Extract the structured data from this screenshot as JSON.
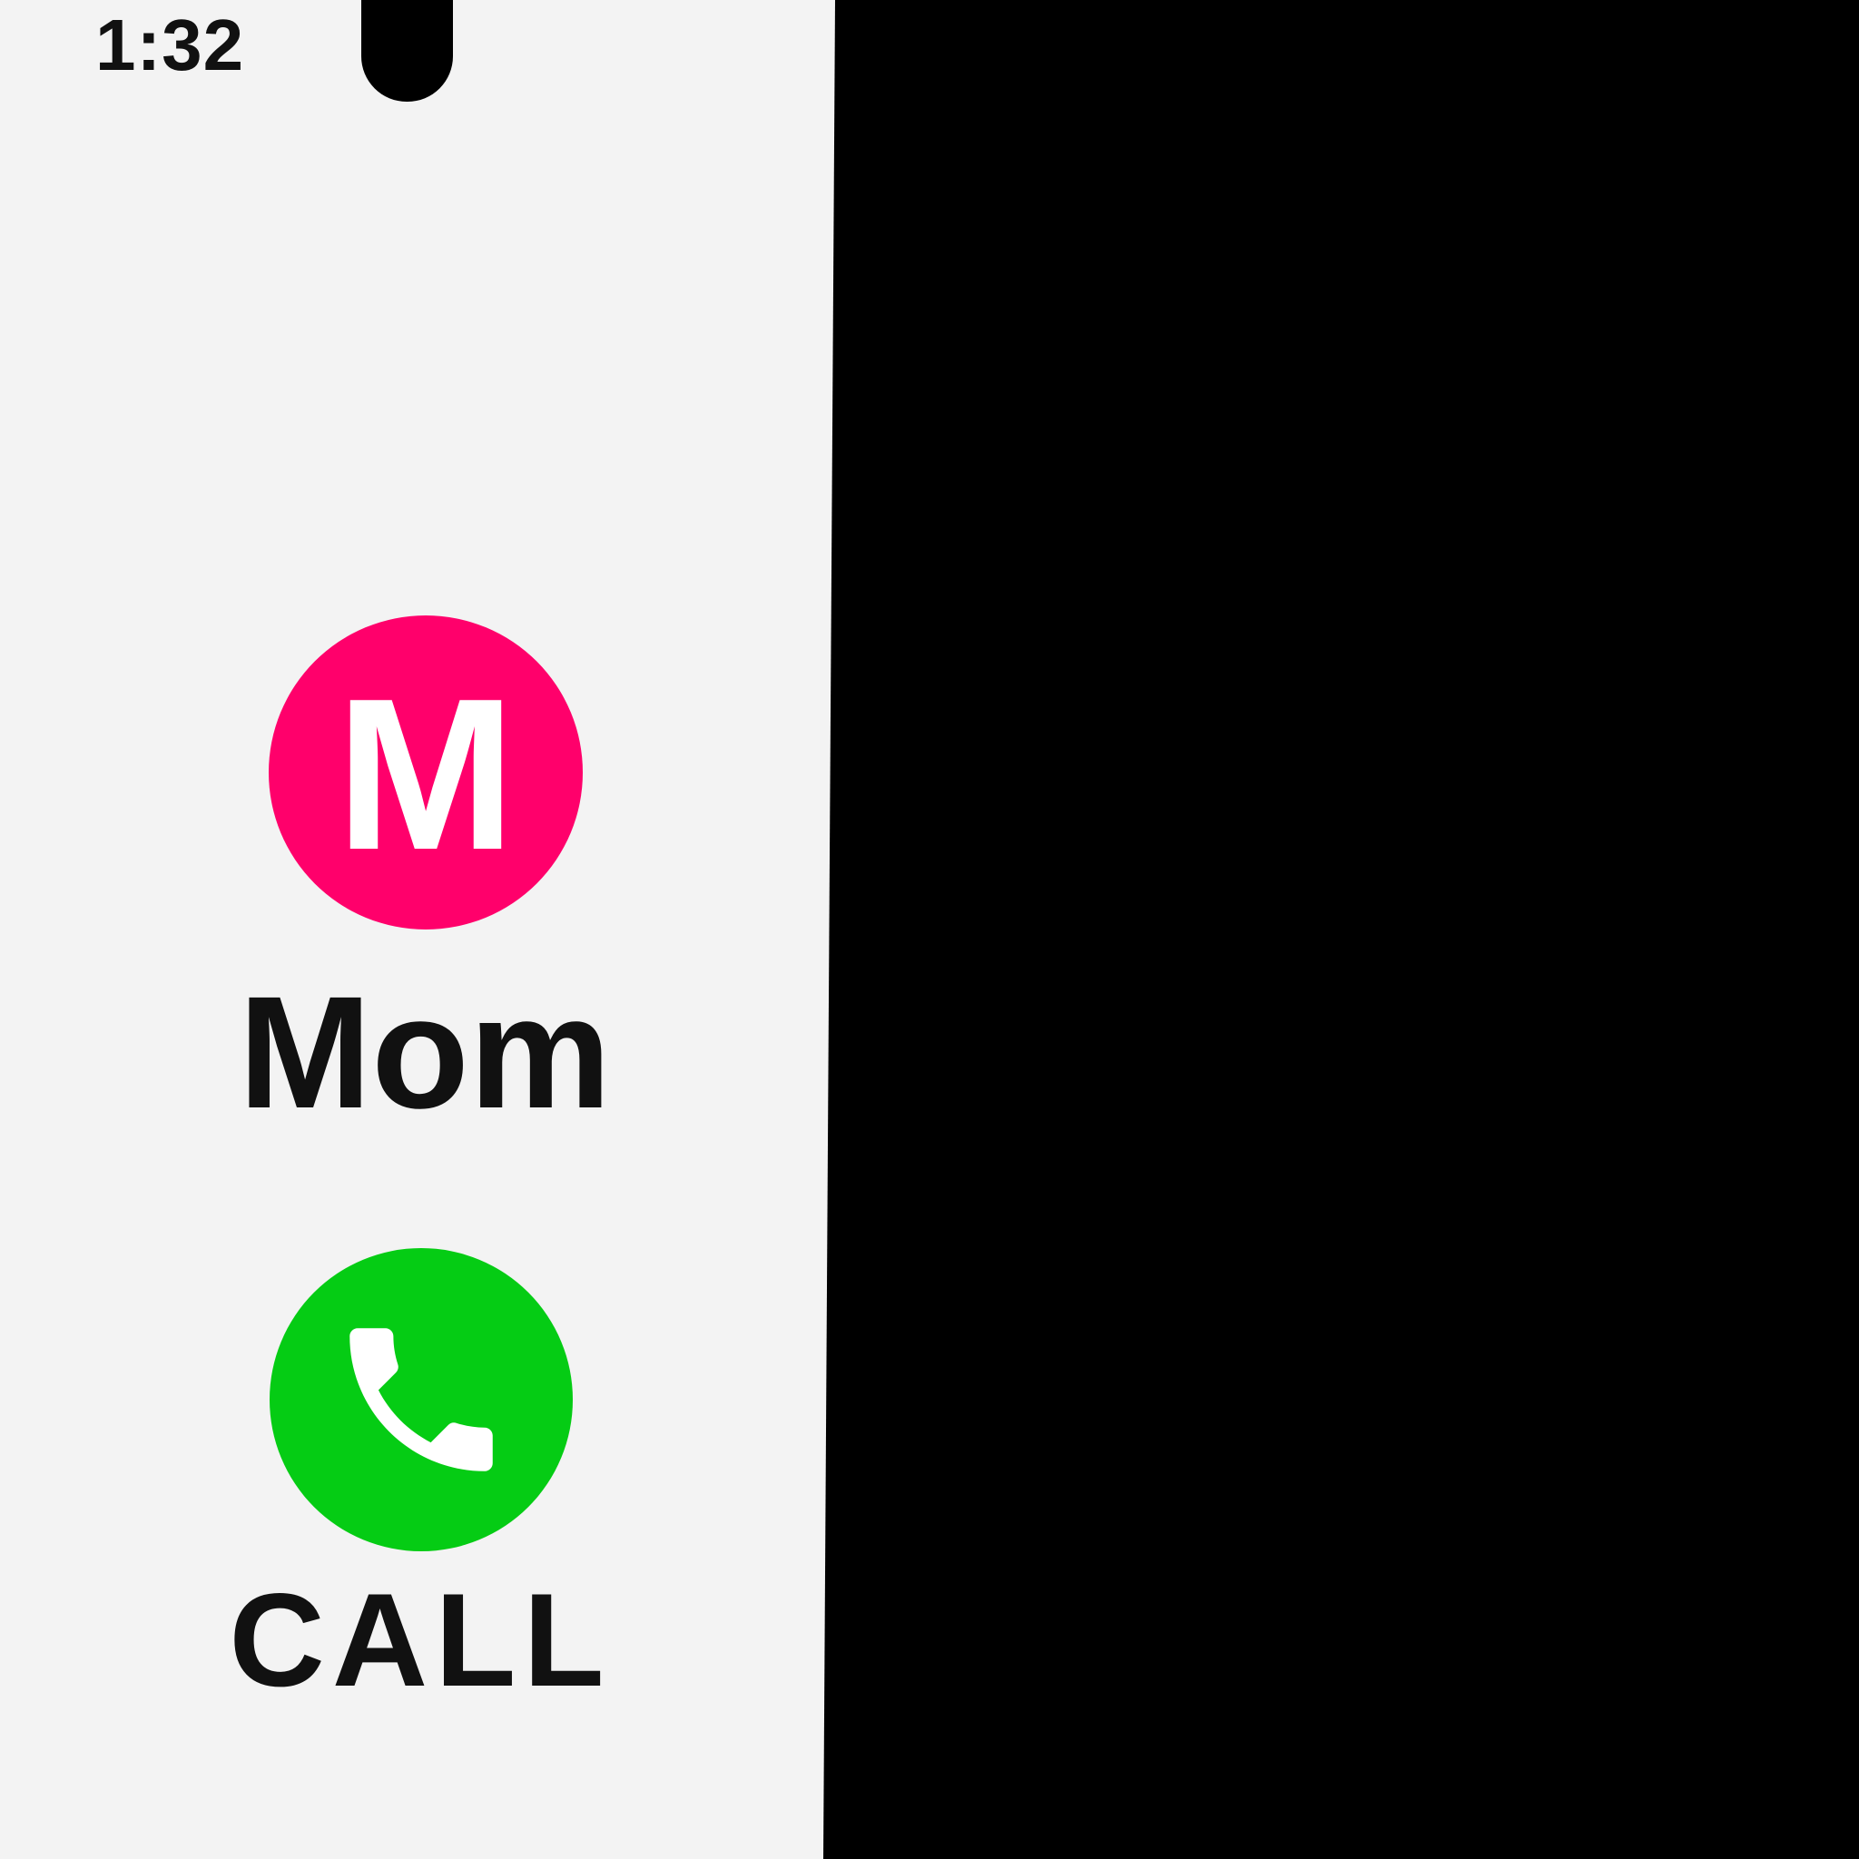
{
  "status_bar": {
    "time": "1:32"
  },
  "contact": {
    "initial": "M",
    "name": "Mom",
    "avatar_color": "#ff006b"
  },
  "call_action": {
    "label": "CALL",
    "icon": "phone-icon",
    "button_color": "#05cc14"
  },
  "colors": {
    "screen_background": "#f3f3f3",
    "outer_background": "#000000",
    "text": "#111111"
  }
}
